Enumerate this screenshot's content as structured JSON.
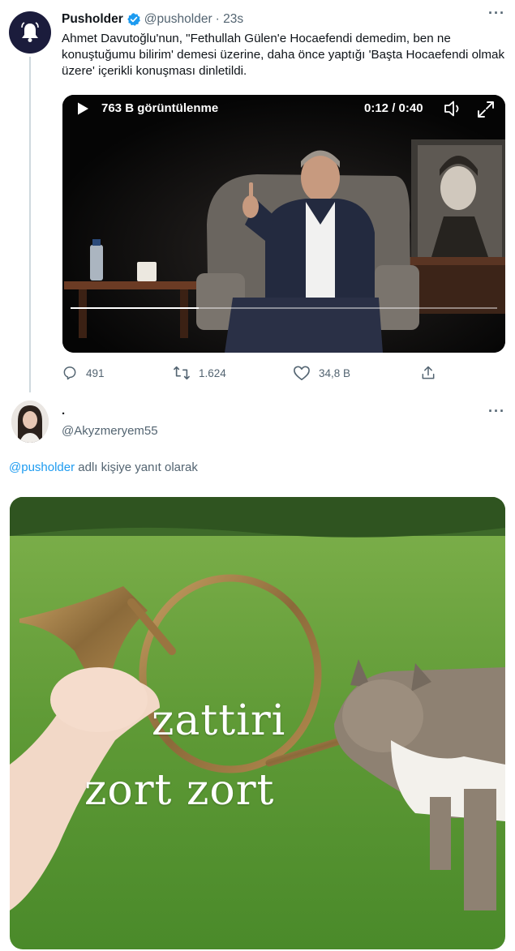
{
  "tweet": {
    "name": "Pusholder",
    "handle": "@pusholder",
    "time": "· 23s",
    "text": "Ahmet Davutoğlu'nun, \"Fethullah Gülen'e Hocaefendi demedim, ben ne konuştuğumu bilirim' demesi üzerine, daha önce yaptığı 'Başta Hocaefendi olmak üzere' içerikli konuşması dinletildi.",
    "video": {
      "views": "763 B görüntülenme",
      "time": "0:12 / 0:40",
      "progress": 0.3
    },
    "actions": {
      "replies": "491",
      "retweets": "1.624",
      "likes": "34,8 B"
    }
  },
  "reply": {
    "name": ".",
    "handle": "@Akyzmeryem55",
    "reply_prefix": "@pusholder",
    "reply_suffix": " adlı kişiye yanıt olarak",
    "meme_line1": "zattiri",
    "meme_line2": "zort zort"
  },
  "colors": {
    "accent": "#1d9bf0",
    "secondary_text": "#536471"
  }
}
